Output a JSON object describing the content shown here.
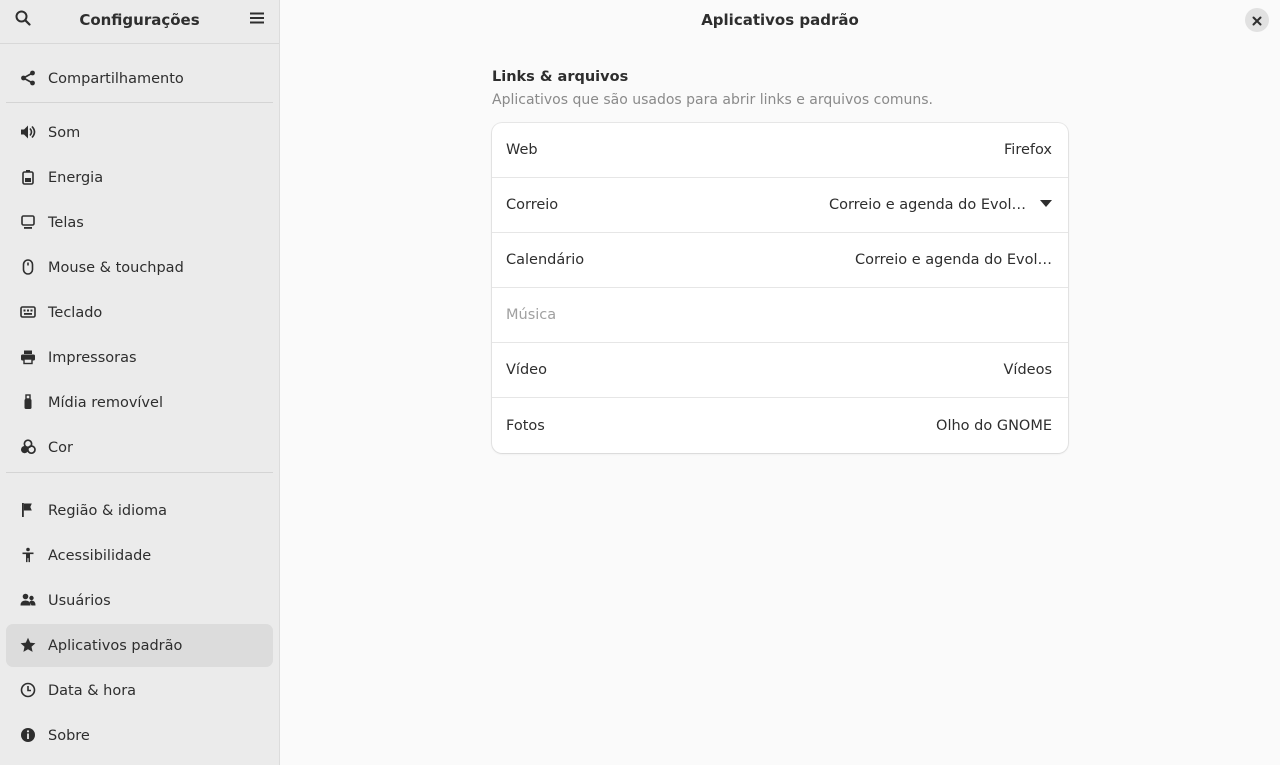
{
  "sidebar": {
    "title": "Configurações",
    "search_icon": "search-icon",
    "menu_icon": "hamburger-menu-icon",
    "group1": [
      {
        "label": "Compartilhamento",
        "icon": "share-icon"
      }
    ],
    "group2": [
      {
        "label": "Som",
        "icon": "speaker-icon"
      },
      {
        "label": "Energia",
        "icon": "battery-icon"
      },
      {
        "label": "Telas",
        "icon": "display-icon"
      },
      {
        "label": "Mouse & touchpad",
        "icon": "mouse-icon"
      },
      {
        "label": "Teclado",
        "icon": "keyboard-icon"
      },
      {
        "label": "Impressoras",
        "icon": "printer-icon"
      },
      {
        "label": "Mídia removível",
        "icon": "usb-drive-icon"
      },
      {
        "label": "Cor",
        "icon": "color-icon"
      }
    ],
    "group3": [
      {
        "label": "Região & idioma",
        "icon": "flag-icon"
      },
      {
        "label": "Acessibilidade",
        "icon": "accessibility-icon"
      },
      {
        "label": "Usuários",
        "icon": "users-icon"
      },
      {
        "label": "Aplicativos padrão",
        "icon": "star-icon",
        "active": true
      },
      {
        "label": "Data & hora",
        "icon": "clock-icon"
      },
      {
        "label": "Sobre",
        "icon": "info-icon"
      }
    ]
  },
  "main": {
    "title": "Aplicativos padrão",
    "close_icon": "close-icon",
    "section_title": "Links & arquivos",
    "section_subtitle": "Aplicativos que são usados para abrir links e arquivos comuns.",
    "rows": [
      {
        "label": "Web",
        "value": "Firefox"
      },
      {
        "label": "Correio",
        "value": "Correio e agenda do Evol…",
        "dropdown": true
      },
      {
        "label": "Calendário",
        "value": "Correio e agenda do Evol…"
      },
      {
        "label": "Música",
        "value": "",
        "disabled": true
      },
      {
        "label": "Vídeo",
        "value": "Vídeos"
      },
      {
        "label": "Fotos",
        "value": "Olho do GNOME"
      }
    ]
  },
  "colors": {
    "sidebar_bg": "#ebebeb",
    "active_item_bg": "#dcdcdc",
    "main_bg": "#fafafa",
    "card_bg": "#ffffff",
    "text": "#2e2e2e",
    "dim_text": "#8a8a8a"
  }
}
